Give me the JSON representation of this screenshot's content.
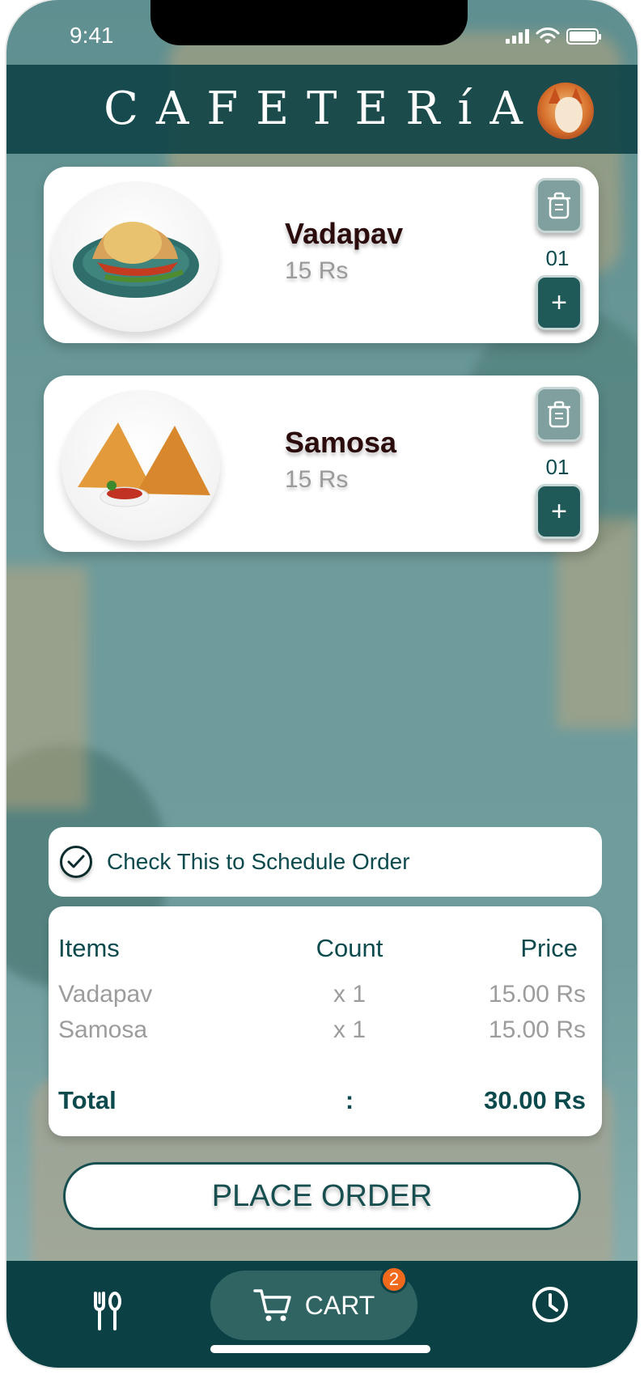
{
  "status_bar": {
    "time": "9:41"
  },
  "header": {
    "title": "CAFETERíA"
  },
  "cart_items": [
    {
      "name": "Vadapav",
      "price": "15 Rs",
      "quantity": "01"
    },
    {
      "name": "Samosa",
      "price": "15 Rs",
      "quantity": "01"
    }
  ],
  "schedule": {
    "label": "Check This to Schedule Order"
  },
  "summary": {
    "headers": {
      "items": "Items",
      "count": "Count",
      "price": "Price"
    },
    "rows": [
      {
        "item": "Vadapav",
        "count": "x 1",
        "price": "15.00 Rs"
      },
      {
        "item": "Samosa",
        "count": "x 1",
        "price": "15.00 Rs"
      }
    ],
    "total": {
      "label": "Total",
      "separator": ":",
      "amount": "30.00 Rs"
    }
  },
  "actions": {
    "place_order": "PLACE ORDER"
  },
  "bottom_nav": {
    "cart_label": "CART",
    "cart_badge": "2",
    "icons": [
      "fork-knife-icon",
      "cart-icon",
      "clock-icon"
    ]
  },
  "colors": {
    "primary": "#0b4145",
    "accent_badge": "#f16a1c",
    "text_teal": "#0d4a4d"
  }
}
